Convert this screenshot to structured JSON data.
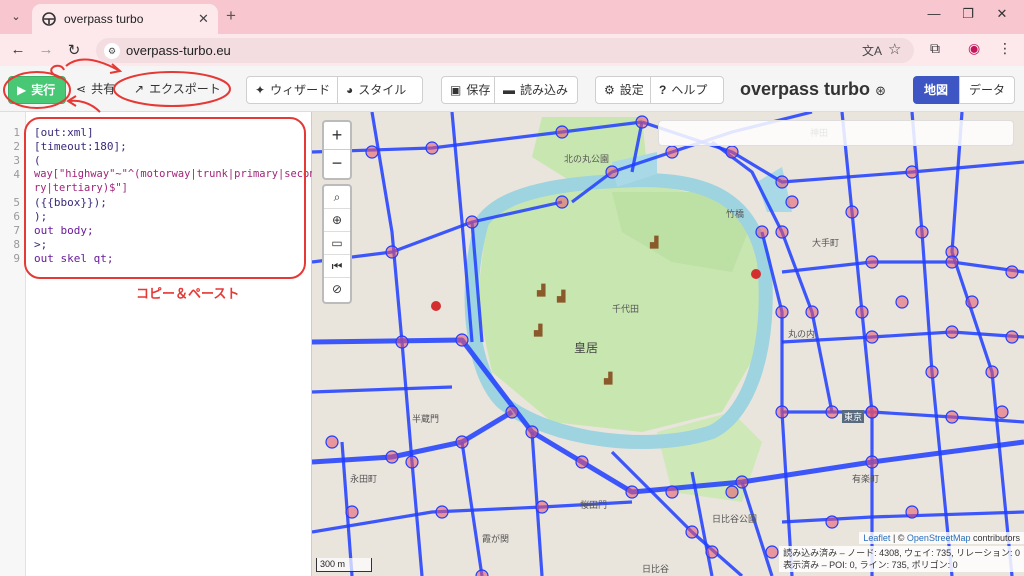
{
  "browser": {
    "tab_title": "overpass turbo",
    "url": "overpass-turbo.eu",
    "icons": [
      "tab-search-icon",
      "close-icon",
      "new-tab-icon",
      "minimize-icon",
      "restore-icon",
      "window-close-icon",
      "back-icon",
      "forward-icon",
      "reload-icon",
      "site-settings-icon",
      "translate-icon",
      "bookmark-star-icon",
      "extensions-icon",
      "profile-icon",
      "menu-icon"
    ]
  },
  "toolbar": {
    "run": "実行",
    "share": "共有",
    "export": "エクスポート",
    "wizard": "ウィザード",
    "style": "スタイル",
    "save": "保存",
    "load": "読み込み",
    "settings": "設定",
    "help": "ヘルプ",
    "app_title": "overpass turbo",
    "map_tab": "地図",
    "data_tab": "データ"
  },
  "editor": {
    "line_numbers": [
      "1",
      "2",
      "3",
      "4",
      "",
      "5",
      "6",
      "7",
      "8",
      "9"
    ],
    "lines": [
      "[out:xml]",
      "[timeout:180];",
      "(",
      "way[\"highway\"~\"^(motorway|trunk|primary|seconda",
      "ry|tertiary)$\"]",
      "({{bbox}});",
      ");",
      "out body;",
      ">;",
      "out skel qt;"
    ]
  },
  "annotation": {
    "note": "コピー＆ペースト",
    "color": "#e53935"
  },
  "map": {
    "zoom_in": "+",
    "zoom_out": "−",
    "scale": "300 m",
    "attribution_leaflet": "Leaflet",
    "attribution_sep": " | © ",
    "attribution_osm": "OpenStreetMap",
    "attribution_tail": " contributors",
    "stats_loaded": "読み込み済み – ノード: 4308, ウェイ: 735, リレーション: 0",
    "stats_shown": "表示済み – POI: 0, ライン: 735, ポリゴン: 0",
    "labels": [
      "北の丸公園",
      "皇居",
      "千代田",
      "竹橋",
      "神田",
      "東京",
      "有楽町",
      "日比谷公園",
      "永田町",
      "半蔵門",
      "桜田門",
      "日比谷",
      "大手町",
      "丸の内",
      "霞が関"
    ],
    "road_color": "#1e3dff",
    "node_color": "#e8566b"
  }
}
